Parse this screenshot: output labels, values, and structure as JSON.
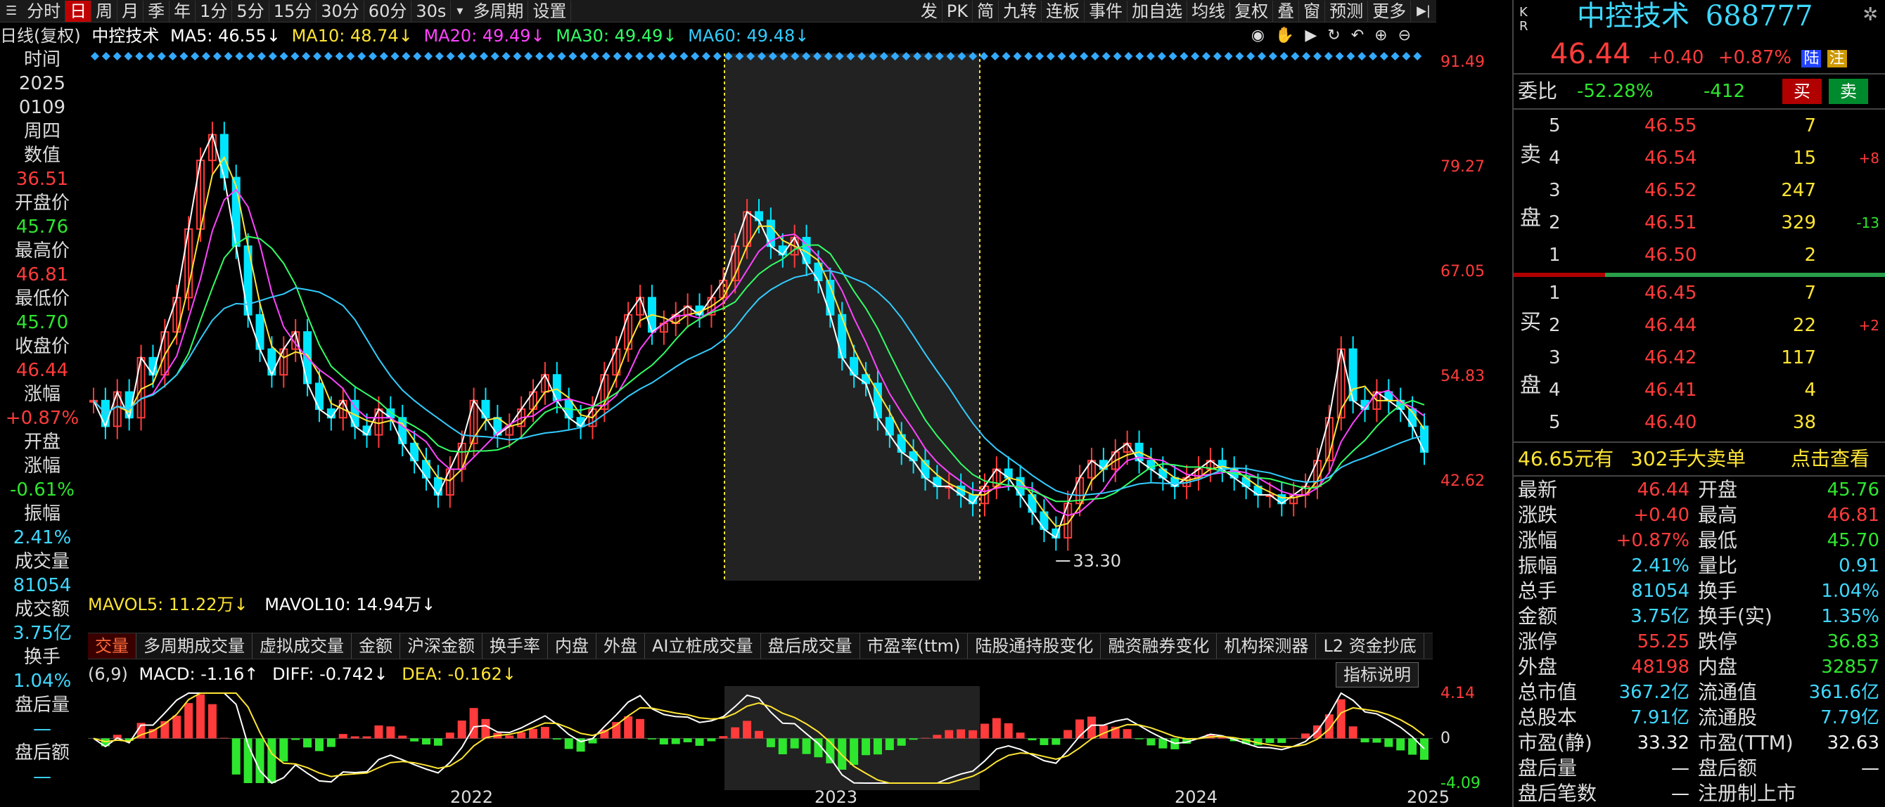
{
  "toolbar": {
    "periods": [
      "分时",
      "日",
      "周",
      "月",
      "季",
      "年",
      "1分",
      "5分",
      "15分",
      "30分",
      "60分",
      "30s"
    ],
    "active_period": "日",
    "more": [
      "多周期",
      "设置"
    ],
    "right_tools": [
      "发",
      "PK",
      "简",
      "九转",
      "连板",
      "事件",
      "加自选",
      "均线",
      "复权",
      "叠",
      "窗",
      "预测",
      "更多"
    ]
  },
  "ma_line": {
    "title": "日线(复权)",
    "stock": "中控技术",
    "ma5": "MA5: 46.55↓",
    "ma10": "MA10: 48.74↓",
    "ma20": "MA20: 49.49↓",
    "ma30": "MA30: 49.49↓",
    "ma60": "MA60: 49.48↓"
  },
  "left_info": [
    {
      "t": "时间",
      "c": "lbl"
    },
    {
      "t": "2025",
      "c": "lbl"
    },
    {
      "t": "0109",
      "c": "lbl"
    },
    {
      "t": "周四",
      "c": "lbl"
    },
    {
      "t": "数值",
      "c": "lbl"
    },
    {
      "t": "36.51",
      "c": "red"
    },
    {
      "t": "开盘价",
      "c": "lbl"
    },
    {
      "t": "45.76",
      "c": "green"
    },
    {
      "t": "最高价",
      "c": "lbl"
    },
    {
      "t": "46.81",
      "c": "red"
    },
    {
      "t": "最低价",
      "c": "lbl"
    },
    {
      "t": "45.70",
      "c": "green"
    },
    {
      "t": "收盘价",
      "c": "lbl"
    },
    {
      "t": "46.44",
      "c": "red"
    },
    {
      "t": "涨幅",
      "c": "lbl"
    },
    {
      "t": "+0.87%",
      "c": "red"
    },
    {
      "t": "开盘",
      "c": "lbl"
    },
    {
      "t": "涨幅",
      "c": "lbl"
    },
    {
      "t": "-0.61%",
      "c": "green"
    },
    {
      "t": "振幅",
      "c": "lbl"
    },
    {
      "t": "2.41%",
      "c": "cyan"
    },
    {
      "t": "成交量",
      "c": "lbl"
    },
    {
      "t": "81054",
      "c": "cyan"
    },
    {
      "t": "成交额",
      "c": "lbl"
    },
    {
      "t": "3.75亿",
      "c": "cyan"
    },
    {
      "t": "换手",
      "c": "lbl"
    },
    {
      "t": "1.04%",
      "c": "cyan"
    },
    {
      "t": "盘后量",
      "c": "lbl"
    },
    {
      "t": "—",
      "c": "cyan"
    },
    {
      "t": "盘后额",
      "c": "lbl"
    },
    {
      "t": "—",
      "c": "cyan"
    }
  ],
  "y_axis": [
    "91.49",
    "79.27",
    "67.05",
    "54.83",
    "42.62"
  ],
  "macd_axis": [
    "4.14",
    "0",
    "-4.09"
  ],
  "low_label": "33.30",
  "years": [
    "2022",
    "2023",
    "2024",
    "2025"
  ],
  "volume_line": {
    "mavol5": "MAVOL5: 11.22万↓",
    "mavol10": "MAVOL10: 14.94万↓"
  },
  "tabs": [
    "交量",
    "多周期成交量",
    "虚拟成交量",
    "金额",
    "沪深金额",
    "换手率",
    "内盘",
    "外盘",
    "AI立桩成交量",
    "盘后成交量",
    "市盈率(ttm)",
    "陆股通持股变化",
    "融资融券变化",
    "机构探测器",
    "L2 资金抄底"
  ],
  "macd_line": {
    "param": "(6,9)",
    "macd": "MACD: -1.16↑",
    "diff": "DIFF: -0.742↓",
    "dea": "DEA: -0.162↓",
    "help": "指标说明"
  },
  "quote": {
    "name": "中控技术",
    "code": "688777",
    "price": "46.44",
    "change": "+0.40",
    "pct": "+0.87%",
    "tag1": "陆",
    "tag2": "注",
    "wei_label": "委比",
    "wei_ratio": "-52.28%",
    "wei_diff": "-412",
    "buy_btn": "买",
    "sell_btn": "卖"
  },
  "sell_orders": [
    {
      "lvl": "5",
      "price": "46.55",
      "vol": "7",
      "chg": ""
    },
    {
      "lvl": "4",
      "price": "46.54",
      "vol": "15",
      "chg": "+8"
    },
    {
      "lvl": "3",
      "price": "46.52",
      "vol": "247",
      "chg": ""
    },
    {
      "lvl": "2",
      "price": "46.51",
      "vol": "329",
      "chg": "-13"
    },
    {
      "lvl": "1",
      "price": "46.50",
      "vol": "2",
      "chg": ""
    }
  ],
  "buy_orders": [
    {
      "lvl": "1",
      "price": "46.45",
      "vol": "7",
      "chg": ""
    },
    {
      "lvl": "2",
      "price": "46.44",
      "vol": "22",
      "chg": "+2"
    },
    {
      "lvl": "3",
      "price": "46.42",
      "vol": "117",
      "chg": ""
    },
    {
      "lvl": "4",
      "price": "46.41",
      "vol": "4",
      "chg": ""
    },
    {
      "lvl": "5",
      "price": "46.40",
      "vol": "38",
      "chg": ""
    }
  ],
  "sell_label": [
    "卖",
    "盘"
  ],
  "buy_label": [
    "买",
    "盘"
  ],
  "big_order": {
    "amount": "46.65元有",
    "hands": "302手",
    "type": "大卖单",
    "link": "点击查看"
  },
  "stats": [
    {
      "l1": "最新",
      "v1": "46.44",
      "c1": "red",
      "l2": "开盘",
      "v2": "45.76",
      "c2": "green"
    },
    {
      "l1": "涨跌",
      "v1": "+0.40",
      "c1": "red",
      "l2": "最高",
      "v2": "46.81",
      "c2": "red"
    },
    {
      "l1": "涨幅",
      "v1": "+0.87%",
      "c1": "red",
      "l2": "最低",
      "v2": "45.70",
      "c2": "green"
    },
    {
      "l1": "振幅",
      "v1": "2.41%",
      "c1": "cyan",
      "l2": "量比",
      "v2": "0.91",
      "c2": "cyan"
    },
    {
      "l1": "总手",
      "v1": "81054",
      "c1": "cyan",
      "l2": "换手",
      "v2": "1.04%",
      "c2": "cyan"
    },
    {
      "l1": "金额",
      "v1": "3.75亿",
      "c1": "cyan",
      "l2": "换手(实)",
      "v2": "1.35%",
      "c2": "cyan"
    },
    {
      "l1": "涨停",
      "v1": "55.25",
      "c1": "red",
      "l2": "跌停",
      "v2": "36.83",
      "c2": "green"
    },
    {
      "l1": "外盘",
      "v1": "48198",
      "c1": "red",
      "l2": "内盘",
      "v2": "32857",
      "c2": "green"
    },
    {
      "l1": "总市值",
      "v1": "367.2亿",
      "c1": "cyan",
      "l2": "流通值",
      "v2": "361.6亿",
      "c2": "cyan"
    },
    {
      "l1": "总股本",
      "v1": "7.91亿",
      "c1": "cyan",
      "l2": "流通股",
      "v2": "7.79亿",
      "c2": "cyan"
    },
    {
      "l1": "市盈(静)",
      "v1": "33.32",
      "c1": "white",
      "l2": "市盈(TTM)",
      "v2": "32.63",
      "c2": "white"
    },
    {
      "l1": "盘后量",
      "v1": "—",
      "c1": "white",
      "l2": "盘后额",
      "v2": "—",
      "c2": "white"
    },
    {
      "l1": "盘后笔数",
      "v1": "—",
      "c1": "white",
      "l2": "注册制上市",
      "v2": "",
      "c2": "white"
    }
  ],
  "colors": {
    "up": "#ff3b3b",
    "down": "#2ee62e",
    "ma5": "#ffffff",
    "ma10": "#ffe533",
    "ma20": "#ff44ff",
    "ma30": "#33ff66",
    "ma60": "#33ccff",
    "highlight_zone": "#222222"
  },
  "chart_data": {
    "type": "line",
    "title": "",
    "x_range": [
      "2021-06",
      "2025-01"
    ],
    "ylim": [
      33.3,
      91.49
    ],
    "close_series": [
      52,
      49,
      53,
      50,
      57,
      55,
      60,
      64,
      72,
      80,
      83,
      78,
      70,
      62,
      58,
      55,
      58,
      60,
      54,
      51,
      50,
      52,
      49,
      48,
      51,
      50,
      47,
      45,
      43,
      41,
      44,
      47,
      52,
      50,
      48,
      49,
      51,
      53,
      55,
      52,
      50,
      49,
      51,
      55,
      58,
      62,
      64,
      60,
      61,
      62,
      63,
      62,
      64,
      66,
      70,
      74,
      73,
      70,
      69,
      71,
      68,
      66,
      62,
      57,
      55,
      54,
      50,
      48,
      46,
      45,
      43,
      42,
      42,
      41,
      40,
      42,
      44,
      43,
      41,
      39,
      37,
      36,
      40,
      43,
      45,
      44,
      46,
      47,
      45,
      44,
      43,
      42,
      43,
      44,
      45,
      44,
      43,
      42,
      41,
      41,
      40,
      41,
      42,
      45,
      50,
      58,
      52,
      51,
      53,
      52,
      51,
      49,
      46
    ],
    "low_marker": {
      "value": 33.3
    },
    "macd_range": [
      -4.09,
      4.14
    ]
  }
}
